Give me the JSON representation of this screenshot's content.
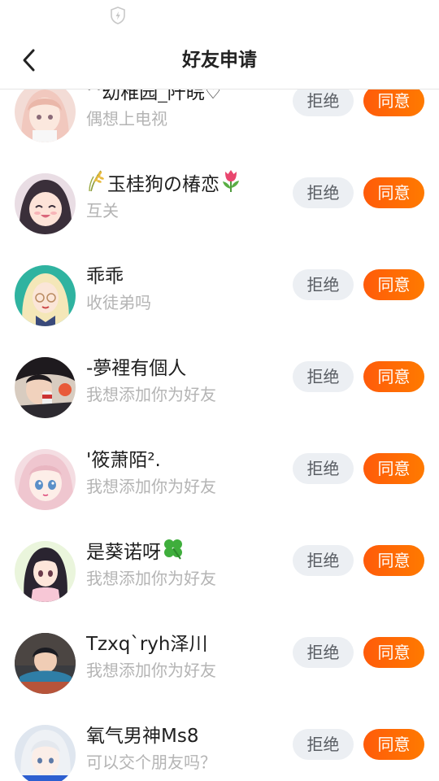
{
  "status_bar": {
    "icon": "shield-bolt-icon"
  },
  "nav": {
    "back_icon": "chevron-left-icon",
    "title": "好友申请"
  },
  "buttons": {
    "reject_label": "拒绝",
    "accept_label": "同意"
  },
  "requests": [
    {
      "name": "^幼稚园_阡皖♡",
      "prefix_icon": "",
      "suffix_icon": "",
      "message": "偶想上电视",
      "avatar": "pink-haired-girl-avatar"
    },
    {
      "name": "玉桂狗の椿恋",
      "prefix_icon": "wheat-sprig-icon",
      "suffix_icon": "tulip-icon",
      "message": "互关",
      "avatar": "laughing-girl-avatar"
    },
    {
      "name": "乖乖",
      "prefix_icon": "",
      "suffix_icon": "",
      "message": "收徒弟吗",
      "avatar": "blonde-girl-glasses-avatar"
    },
    {
      "name": "-夢裡有個人",
      "prefix_icon": "",
      "suffix_icon": "",
      "message": "我想添加你为好友",
      "avatar": "boy-drinking-avatar"
    },
    {
      "name": "'筱萧陌².",
      "prefix_icon": "",
      "suffix_icon": "",
      "message": "我想添加你为好友",
      "avatar": "blue-eyed-girl-avatar"
    },
    {
      "name": "是葵诺呀",
      "prefix_icon": "",
      "suffix_icon": "four-leaf-clover-icon",
      "message": "我想添加你为好友",
      "avatar": "dark-haired-girl-avatar"
    },
    {
      "name": "Tzxq`ryh泽川",
      "prefix_icon": "",
      "suffix_icon": "",
      "message": "我想添加你为好友",
      "avatar": "boy-on-desk-avatar"
    },
    {
      "name": "氧气男神Ms8",
      "prefix_icon": "",
      "suffix_icon": "",
      "message": "可以交个朋友吗？",
      "avatar": "white-haired-boy-avatar"
    }
  ]
}
